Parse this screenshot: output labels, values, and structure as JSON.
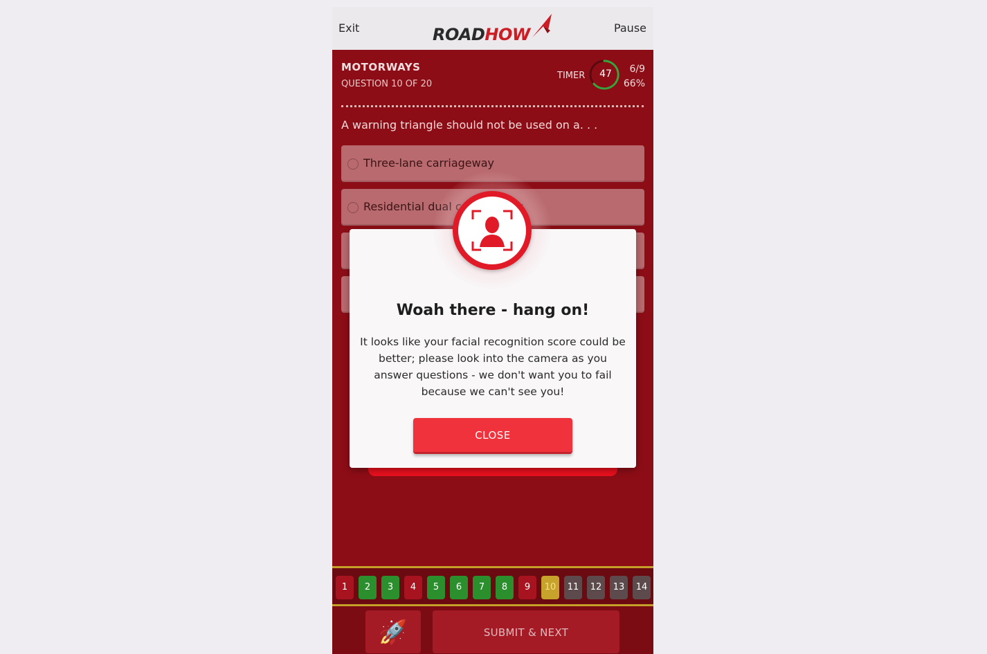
{
  "topbar": {
    "exit_label": "Exit",
    "pause_label": "Pause",
    "logo_road": "ROAD",
    "logo_how": "HOW"
  },
  "quiz": {
    "category": "MOTORWAYS",
    "question_counter": "QUESTION 10 OF 20",
    "timer_label": "TIMER",
    "timer_value": "47",
    "score_fraction": "6/9",
    "score_percent": "66%",
    "question_text": "A warning triangle should not be used on a. . .",
    "answers": [
      {
        "label": "Three-lane carriageway"
      },
      {
        "label": "Residential dual carriageway"
      }
    ]
  },
  "nav": {
    "numbers": [
      "1",
      "2",
      "3",
      "4",
      "5",
      "6",
      "7",
      "8",
      "9",
      "10",
      "11",
      "12",
      "13",
      "14"
    ],
    "states": [
      "wrong",
      "correct",
      "correct",
      "wrong",
      "correct",
      "correct",
      "correct",
      "correct",
      "wrong",
      "current",
      "pending",
      "pending",
      "pending",
      "pending"
    ]
  },
  "bottom": {
    "rocket_icon": "rocket-icon",
    "submit_label": "SUBMIT & NEXT"
  },
  "modal": {
    "icon": "face-recognition-icon",
    "title": "Woah there - hang on!",
    "message": "It looks like your facial recognition score could be better; please look into the camera as you answer questions - we don't want you to fail because we can't see you!",
    "close_label": "CLOSE"
  },
  "colors": {
    "accent": "#e11a27",
    "background": "#8d0d16",
    "correct": "#2b8f2d",
    "wrong": "#a81320",
    "current": "#c8a32c"
  }
}
